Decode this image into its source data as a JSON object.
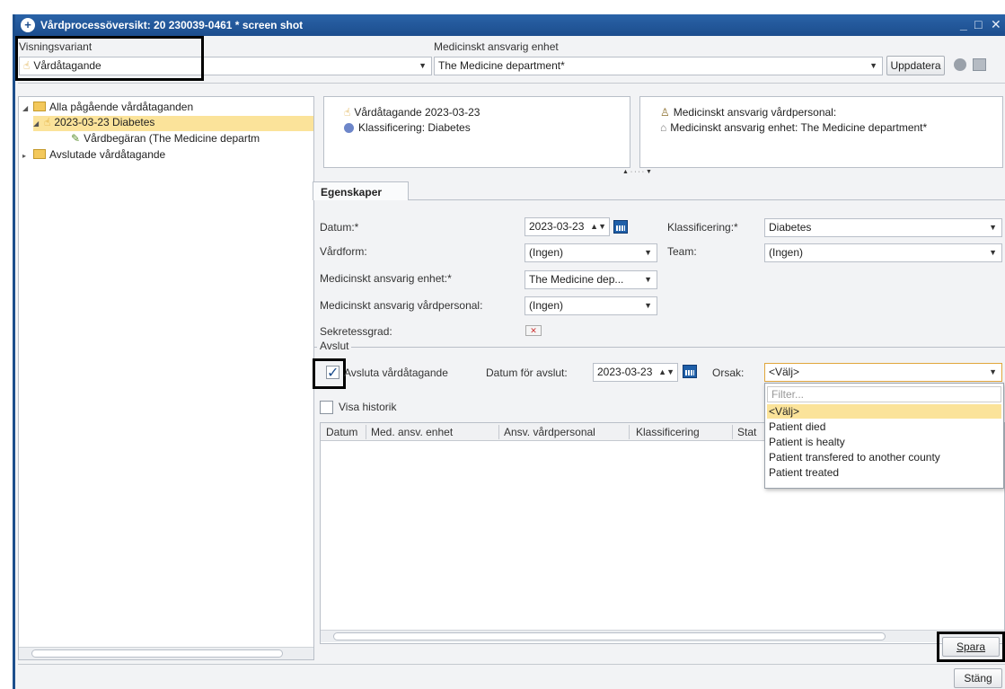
{
  "window": {
    "title": "Vårdprocessöversikt: 20 230039-0461 * screen shot",
    "minimize": "_",
    "maximize": "□",
    "close": "✕"
  },
  "top": {
    "view_label": "Visningsvariant",
    "view_value": "Vårdåtagande",
    "unit_label": "Medicinskt ansvarig enhet",
    "unit_value": "The Medicine department*",
    "update_button": "Uppdatera"
  },
  "tree": {
    "items": [
      {
        "label": "Alla pågående vårdåtaganden"
      },
      {
        "label": "2023-03-23  Diabetes"
      },
      {
        "label": "Vårdbegäran (The Medicine departm"
      },
      {
        "label": "Avslutade vårdåtagande"
      }
    ]
  },
  "summary": {
    "left": [
      "Vårdåtagande 2023-03-23",
      "Klassificering: Diabetes"
    ],
    "right": [
      "Medicinskt ansvarig vårdpersonal:",
      "Medicinskt ansvarig enhet: The Medicine department*"
    ]
  },
  "tabs": {
    "properties": "Egenskaper"
  },
  "form": {
    "date_label": "Datum:*",
    "date_value": "2023-03-23",
    "care_form_label": "Vårdform:",
    "care_form_value": "(Ingen)",
    "unit_label": "Medicinskt ansvarig enhet:*",
    "unit_value": "The Medicine dep...",
    "staff_label": "Medicinskt ansvarig vårdpersonal:",
    "staff_value": "(Ingen)",
    "secrecy_label": "Sekretessgrad:",
    "class_label": "Klassificering:*",
    "class_value": "Diabetes",
    "team_label": "Team:",
    "team_value": "(Ingen)"
  },
  "close_section": {
    "group_label": "Avslut",
    "checkbox_label": "Avsluta vårdåtagande",
    "checkbox_checked": true,
    "end_date_label": "Datum för avslut:",
    "end_date_value": "2023-03-23",
    "reason_label": "Orsak:",
    "reason_value": "<Välj>",
    "reason_options": {
      "filter_placeholder": "Filter...",
      "items": [
        "<Välj>",
        "Patient died",
        "Patient is healty",
        "Patient transfered to another county",
        "Patient treated"
      ]
    }
  },
  "history": {
    "checkbox_label": "Visa historik",
    "columns": [
      "Datum",
      "Med. ansv. enhet",
      "Ansv. vårdpersonal",
      "Klassificering",
      "Stat"
    ]
  },
  "buttons": {
    "save": "Spara",
    "close": "Stäng"
  },
  "glyphs": {
    "caret": "▼",
    "spin": "▲▼",
    "nav": "▲ · · · · ▼",
    "check": "✓"
  }
}
